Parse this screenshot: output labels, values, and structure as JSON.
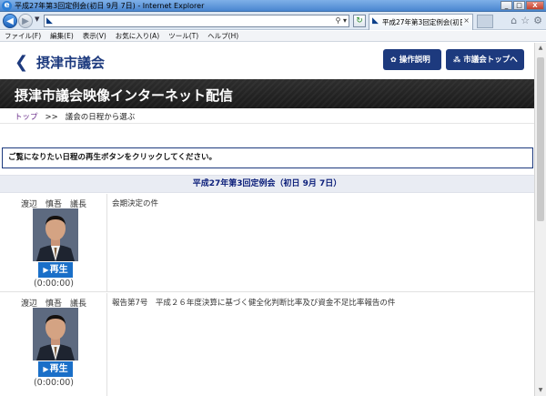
{
  "window": {
    "title": "平成27年第3回定例会(初日 9月 7日) - Internet Explorer",
    "tab_label": "平成27年第3回定例会(初日...",
    "controls": {
      "minimize": "_",
      "maximize": "□",
      "close": "X"
    }
  },
  "menu": [
    "ファイル(F)",
    "編集(E)",
    "表示(V)",
    "お気に入り(A)",
    "ツール(T)",
    "ヘルプ(H)"
  ],
  "icons": [
    "ie-logo-icon",
    "back-icon",
    "forward-icon",
    "search-icon",
    "refresh-icon",
    "home-icon",
    "favorites-star-icon",
    "settings-gear-icon",
    "info-icon",
    "committee-icon",
    "play-icon"
  ],
  "colors": {
    "brand_navy": "#1d3a7e",
    "banner_dark": "#222222",
    "play_blue": "#1a6fc8",
    "session_bg": "#e9ecf3",
    "link_purple": "#6a2e8a"
  },
  "site": {
    "logo_text": "摂津市議会",
    "help_button": "操作説明",
    "top_button": "市議会トップへ",
    "banner_title": "摂津市議会映像インターネット配信"
  },
  "breadcrumb": {
    "home": "トップ",
    "separator": ">>",
    "current": "議会の日程から選ぶ"
  },
  "instruction": "ご覧になりたい日程の再生ボタンをクリックしてください。",
  "session_title": "平成27年第3回定例会（初日 9月 7日）",
  "speeches": [
    {
      "speaker": "渡辺　慎吾　議長",
      "play_label": "再生",
      "duration": "(0:00:00)",
      "agenda": "会期決定の件"
    },
    {
      "speaker": "渡辺　慎吾　議長",
      "play_label": "再生",
      "duration": "(0:00:00)",
      "agenda": "報告第7号　平成２６年度決算に基づく健全化判断比率及び資金不足比率報告の件"
    }
  ]
}
